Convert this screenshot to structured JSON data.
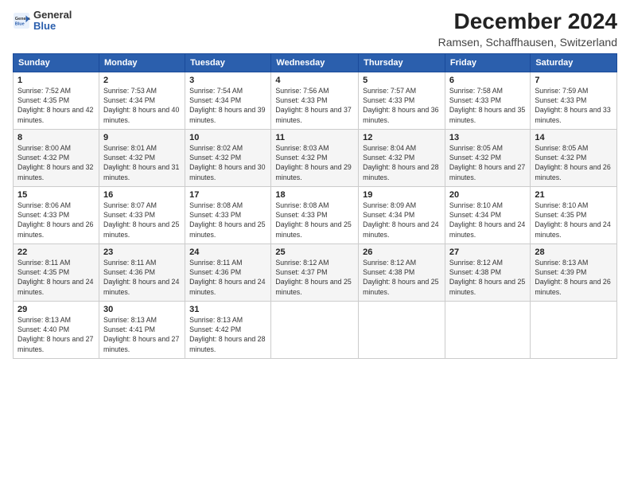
{
  "header": {
    "logo_general": "General",
    "logo_blue": "Blue",
    "title": "December 2024",
    "subtitle": "Ramsen, Schaffhausen, Switzerland"
  },
  "weekdays": [
    "Sunday",
    "Monday",
    "Tuesday",
    "Wednesday",
    "Thursday",
    "Friday",
    "Saturday"
  ],
  "weeks": [
    [
      {
        "day": "1",
        "sunrise": "7:52 AM",
        "sunset": "4:35 PM",
        "daylight": "8 hours and 42 minutes."
      },
      {
        "day": "2",
        "sunrise": "7:53 AM",
        "sunset": "4:34 PM",
        "daylight": "8 hours and 40 minutes."
      },
      {
        "day": "3",
        "sunrise": "7:54 AM",
        "sunset": "4:34 PM",
        "daylight": "8 hours and 39 minutes."
      },
      {
        "day": "4",
        "sunrise": "7:56 AM",
        "sunset": "4:33 PM",
        "daylight": "8 hours and 37 minutes."
      },
      {
        "day": "5",
        "sunrise": "7:57 AM",
        "sunset": "4:33 PM",
        "daylight": "8 hours and 36 minutes."
      },
      {
        "day": "6",
        "sunrise": "7:58 AM",
        "sunset": "4:33 PM",
        "daylight": "8 hours and 35 minutes."
      },
      {
        "day": "7",
        "sunrise": "7:59 AM",
        "sunset": "4:33 PM",
        "daylight": "8 hours and 33 minutes."
      }
    ],
    [
      {
        "day": "8",
        "sunrise": "8:00 AM",
        "sunset": "4:32 PM",
        "daylight": "8 hours and 32 minutes."
      },
      {
        "day": "9",
        "sunrise": "8:01 AM",
        "sunset": "4:32 PM",
        "daylight": "8 hours and 31 minutes."
      },
      {
        "day": "10",
        "sunrise": "8:02 AM",
        "sunset": "4:32 PM",
        "daylight": "8 hours and 30 minutes."
      },
      {
        "day": "11",
        "sunrise": "8:03 AM",
        "sunset": "4:32 PM",
        "daylight": "8 hours and 29 minutes."
      },
      {
        "day": "12",
        "sunrise": "8:04 AM",
        "sunset": "4:32 PM",
        "daylight": "8 hours and 28 minutes."
      },
      {
        "day": "13",
        "sunrise": "8:05 AM",
        "sunset": "4:32 PM",
        "daylight": "8 hours and 27 minutes."
      },
      {
        "day": "14",
        "sunrise": "8:05 AM",
        "sunset": "4:32 PM",
        "daylight": "8 hours and 26 minutes."
      }
    ],
    [
      {
        "day": "15",
        "sunrise": "8:06 AM",
        "sunset": "4:33 PM",
        "daylight": "8 hours and 26 minutes."
      },
      {
        "day": "16",
        "sunrise": "8:07 AM",
        "sunset": "4:33 PM",
        "daylight": "8 hours and 25 minutes."
      },
      {
        "day": "17",
        "sunrise": "8:08 AM",
        "sunset": "4:33 PM",
        "daylight": "8 hours and 25 minutes."
      },
      {
        "day": "18",
        "sunrise": "8:08 AM",
        "sunset": "4:33 PM",
        "daylight": "8 hours and 25 minutes."
      },
      {
        "day": "19",
        "sunrise": "8:09 AM",
        "sunset": "4:34 PM",
        "daylight": "8 hours and 24 minutes."
      },
      {
        "day": "20",
        "sunrise": "8:10 AM",
        "sunset": "4:34 PM",
        "daylight": "8 hours and 24 minutes."
      },
      {
        "day": "21",
        "sunrise": "8:10 AM",
        "sunset": "4:35 PM",
        "daylight": "8 hours and 24 minutes."
      }
    ],
    [
      {
        "day": "22",
        "sunrise": "8:11 AM",
        "sunset": "4:35 PM",
        "daylight": "8 hours and 24 minutes."
      },
      {
        "day": "23",
        "sunrise": "8:11 AM",
        "sunset": "4:36 PM",
        "daylight": "8 hours and 24 minutes."
      },
      {
        "day": "24",
        "sunrise": "8:11 AM",
        "sunset": "4:36 PM",
        "daylight": "8 hours and 24 minutes."
      },
      {
        "day": "25",
        "sunrise": "8:12 AM",
        "sunset": "4:37 PM",
        "daylight": "8 hours and 25 minutes."
      },
      {
        "day": "26",
        "sunrise": "8:12 AM",
        "sunset": "4:38 PM",
        "daylight": "8 hours and 25 minutes."
      },
      {
        "day": "27",
        "sunrise": "8:12 AM",
        "sunset": "4:38 PM",
        "daylight": "8 hours and 25 minutes."
      },
      {
        "day": "28",
        "sunrise": "8:13 AM",
        "sunset": "4:39 PM",
        "daylight": "8 hours and 26 minutes."
      }
    ],
    [
      {
        "day": "29",
        "sunrise": "8:13 AM",
        "sunset": "4:40 PM",
        "daylight": "8 hours and 27 minutes."
      },
      {
        "day": "30",
        "sunrise": "8:13 AM",
        "sunset": "4:41 PM",
        "daylight": "8 hours and 27 minutes."
      },
      {
        "day": "31",
        "sunrise": "8:13 AM",
        "sunset": "4:42 PM",
        "daylight": "8 hours and 28 minutes."
      },
      null,
      null,
      null,
      null
    ]
  ],
  "labels": {
    "sunrise": "Sunrise:",
    "sunset": "Sunset:",
    "daylight": "Daylight:"
  }
}
